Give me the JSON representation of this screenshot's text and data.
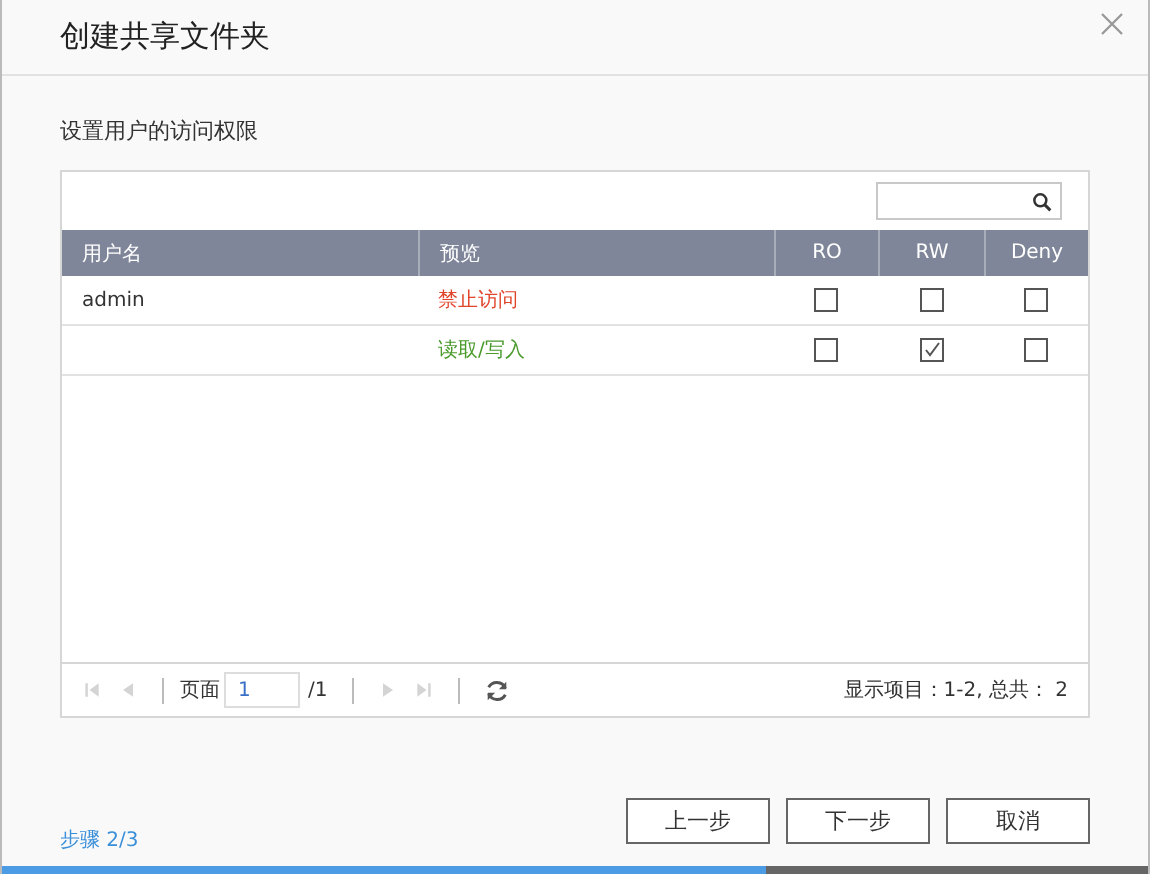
{
  "window": {
    "title": "创建共享文件夹"
  },
  "subtitle": "设置用户的访问权限",
  "table": {
    "columns": [
      "用户名",
      "预览",
      "RO",
      "RW",
      "Deny"
    ],
    "rows": [
      {
        "username": "admin",
        "preview": "禁止访问",
        "kind": "deny",
        "ro": false,
        "rw": false,
        "deny": false
      },
      {
        "preview": "读取/写入",
        "kind": "rw",
        "ro": false,
        "rw": true,
        "deny": false
      }
    ]
  },
  "pager": {
    "nav": [
      {
        "kind": "first",
        "disabled": true
      },
      {
        "kind": "prev",
        "disabled": true
      }
    ],
    "page_label": "页面",
    "page_value": "1",
    "page_total": "/1",
    "nav_after": [
      {
        "kind": "next",
        "disabled": true
      },
      {
        "kind": "last",
        "disabled": true
      }
    ],
    "summary": "显示项目：1-2, 总共： 2"
  },
  "step": "步骤 2/3",
  "buttons": [
    "上一步",
    "下一步",
    "取消"
  ],
  "progress": {
    "level": 0.667
  }
}
